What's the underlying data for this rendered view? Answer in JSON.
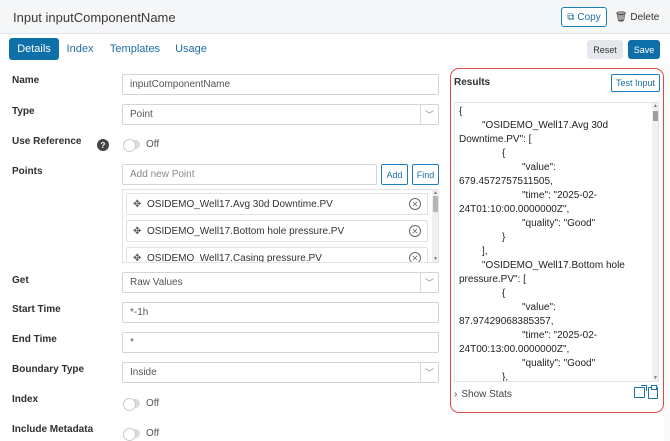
{
  "header": {
    "title": "Input inputComponentName",
    "copy_label": "Copy",
    "delete_label": "Delete"
  },
  "tabs": [
    {
      "label": "Details",
      "active": true
    },
    {
      "label": "Index",
      "active": false
    },
    {
      "label": "Templates",
      "active": false
    },
    {
      "label": "Usage",
      "active": false
    }
  ],
  "actions": {
    "reset_label": "Reset",
    "save_label": "Save"
  },
  "form": {
    "name": {
      "label": "Name",
      "value": "inputComponentName"
    },
    "type": {
      "label": "Type",
      "value": "Point"
    },
    "use_reference": {
      "label": "Use Reference",
      "state": "Off"
    },
    "points": {
      "label": "Points",
      "placeholder": "Add new Point",
      "add_label": "Add",
      "find_label": "Find",
      "items": [
        "OSIDEMO_Well17.Avg 30d Downtime.PV",
        "OSIDEMO_Well17.Bottom hole pressure.PV",
        "OSIDEMO_Well17.Casing pressure.PV"
      ]
    },
    "get": {
      "label": "Get",
      "value": "Raw Values"
    },
    "start_time": {
      "label": "Start Time",
      "value": "*-1h"
    },
    "end_time": {
      "label": "End Time",
      "value": "*"
    },
    "boundary_type": {
      "label": "Boundary Type",
      "value": "Inside"
    },
    "index": {
      "label": "Index",
      "state": "Off"
    },
    "include_metadata": {
      "label": "Include Metadata",
      "state": "Off"
    }
  },
  "results": {
    "title": "Results",
    "test_label": "Test Input",
    "json_lines": [
      "{",
      "\"OSIDEMO_Well17.Avg 30d",
      "Downtime.PV\": [",
      "{",
      "\"value\":",
      "679.4572757511505,",
      "\"time\": \"2025-02-",
      "24T01:10:00.0000000Z\",",
      "\"quality\": \"Good\"",
      "}",
      "],",
      "\"OSIDEMO_Well17.Bottom hole",
      "pressure.PV\": [",
      "{",
      "\"value\":",
      "87.97429068385357,",
      "\"time\": \"2025-02-",
      "24T00:13:00.0000000Z\",",
      "\"quality\": \"Good\"",
      "},"
    ],
    "show_stats_label": "Show Stats"
  }
}
